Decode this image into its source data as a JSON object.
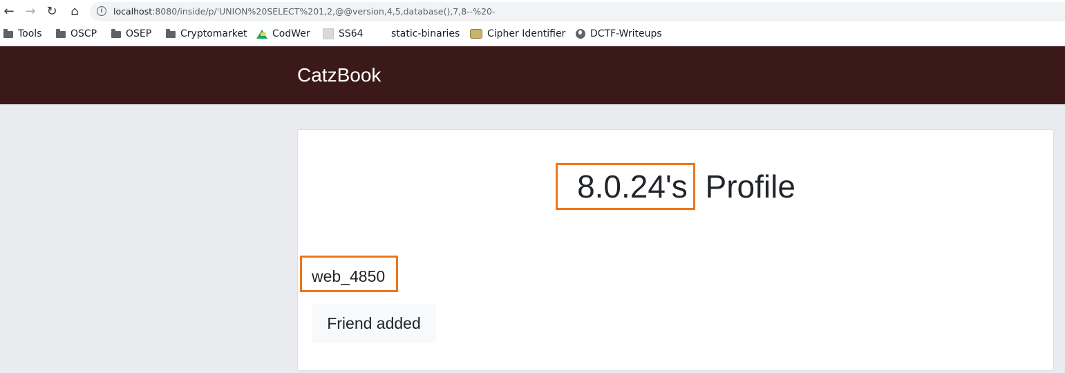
{
  "browser": {
    "url_host": "localhost",
    "url_rest": ":8080/inside/p/'UNION%20SELECT%201,2,@@version,4,5,database(),7,8--%20-",
    "nav": {
      "back": "←",
      "forward": "→",
      "reload": "↻",
      "home": "⌂"
    },
    "bookmarks": [
      {
        "label": "Tools",
        "icon": "folder-icon"
      },
      {
        "label": "OSCP",
        "icon": "folder-icon"
      },
      {
        "label": "OSEP",
        "icon": "folder-icon"
      },
      {
        "label": "Cryptomarket",
        "icon": "folder-icon"
      },
      {
        "label": "CodWer",
        "icon": "google-drive-icon"
      },
      {
        "label": "SS64",
        "icon": "page-icon"
      },
      {
        "label": "static-binaries",
        "icon": ""
      },
      {
        "label": "Cipher Identifier",
        "icon": "cipher-icon"
      },
      {
        "label": "DCTF-Writeups",
        "icon": "globe-icon"
      }
    ]
  },
  "app": {
    "brand": "CatzBook",
    "header_color": "#3b1918",
    "highlight_color": "#ee7618",
    "profile": {
      "name": "8.0.24's",
      "suffix": "Profile",
      "username": "web_4850",
      "friend_button": "Friend added"
    }
  }
}
